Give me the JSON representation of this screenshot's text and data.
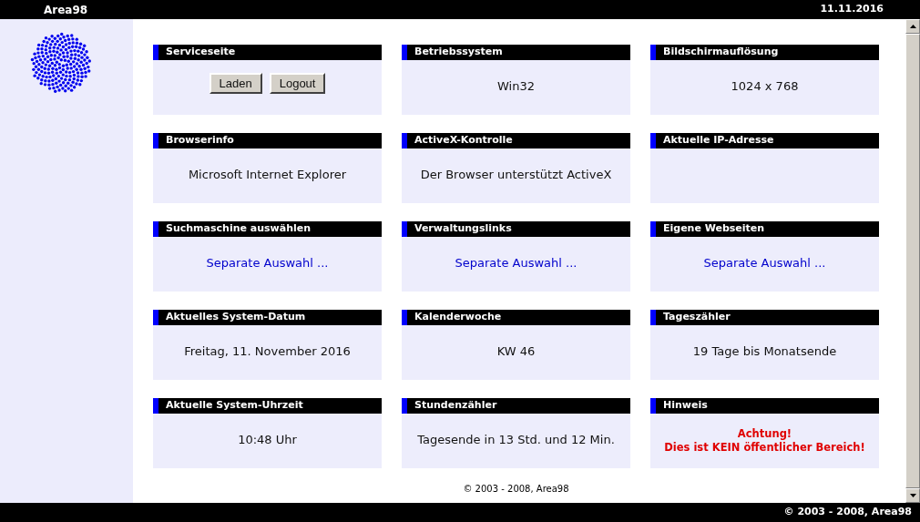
{
  "header": {
    "site_name": "Area98",
    "date": "11.11.2016"
  },
  "cards": [
    {
      "title": "Serviceseite",
      "kind": "buttons",
      "buttons": [
        "Laden",
        "Logout"
      ]
    },
    {
      "title": "Betriebssystem",
      "kind": "text",
      "text": "Win32"
    },
    {
      "title": "Bildschirmauflösung",
      "kind": "text",
      "text": "1024 x 768"
    },
    {
      "title": "Browserinfo",
      "kind": "text",
      "text": "Microsoft Internet Explorer"
    },
    {
      "title": "ActiveX-Kontrolle",
      "kind": "text",
      "text": "Der Browser unterstützt ActiveX"
    },
    {
      "title": "Aktuelle IP-Adresse",
      "kind": "empty"
    },
    {
      "title": "Suchmaschine auswählen",
      "kind": "link",
      "text": "Separate Auswahl ..."
    },
    {
      "title": "Verwaltungslinks",
      "kind": "link",
      "text": "Separate Auswahl ..."
    },
    {
      "title": "Eigene Webseiten",
      "kind": "link",
      "text": "Separate Auswahl ..."
    },
    {
      "title": "Aktuelles System-Datum",
      "kind": "text",
      "text": "Freitag, 11. November 2016"
    },
    {
      "title": "Kalenderwoche",
      "kind": "text",
      "text": "KW 46"
    },
    {
      "title": "Tageszähler",
      "kind": "text",
      "text": "19 Tage bis Monatsende"
    },
    {
      "title": "Aktuelle System-Uhrzeit",
      "kind": "text",
      "text": "10:48 Uhr"
    },
    {
      "title": "Stundenzähler",
      "kind": "text",
      "text": "Tagesende in 13 Std. und 12 Min."
    },
    {
      "title": "Hinweis",
      "kind": "warning",
      "lines": [
        "Achtung!",
        "Dies ist KEIN öffentlicher Bereich!"
      ]
    }
  ],
  "content_footer": "© 2003 - 2008, Area98",
  "footer": "© 2003 - 2008, Area98"
}
